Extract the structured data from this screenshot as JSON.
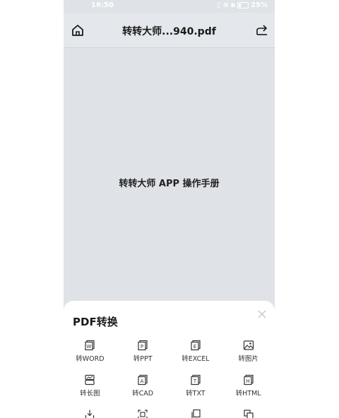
{
  "status_bar": {
    "time": "16:50",
    "battery": "25%"
  },
  "header": {
    "title": "转转大师...940.pdf"
  },
  "document": {
    "text": "转转大师 APP 操作手册"
  },
  "sheet": {
    "title": "PDF转换",
    "items": [
      {
        "label": "转WORD",
        "glyph": "W"
      },
      {
        "label": "转PPT",
        "glyph": "P"
      },
      {
        "label": "转EXCEL",
        "glyph": "E"
      },
      {
        "label": "转图片",
        "glyph": "img"
      },
      {
        "label": "转长图",
        "glyph": "long"
      },
      {
        "label": "转CAD",
        "glyph": "A"
      },
      {
        "label": "转TXT",
        "glyph": "T"
      },
      {
        "label": "转HTML",
        "glyph": "H"
      },
      {
        "label": "",
        "glyph": "download"
      },
      {
        "label": "",
        "glyph": "scan"
      },
      {
        "label": "",
        "glyph": "copy"
      },
      {
        "label": "",
        "glyph": "merge"
      }
    ]
  }
}
